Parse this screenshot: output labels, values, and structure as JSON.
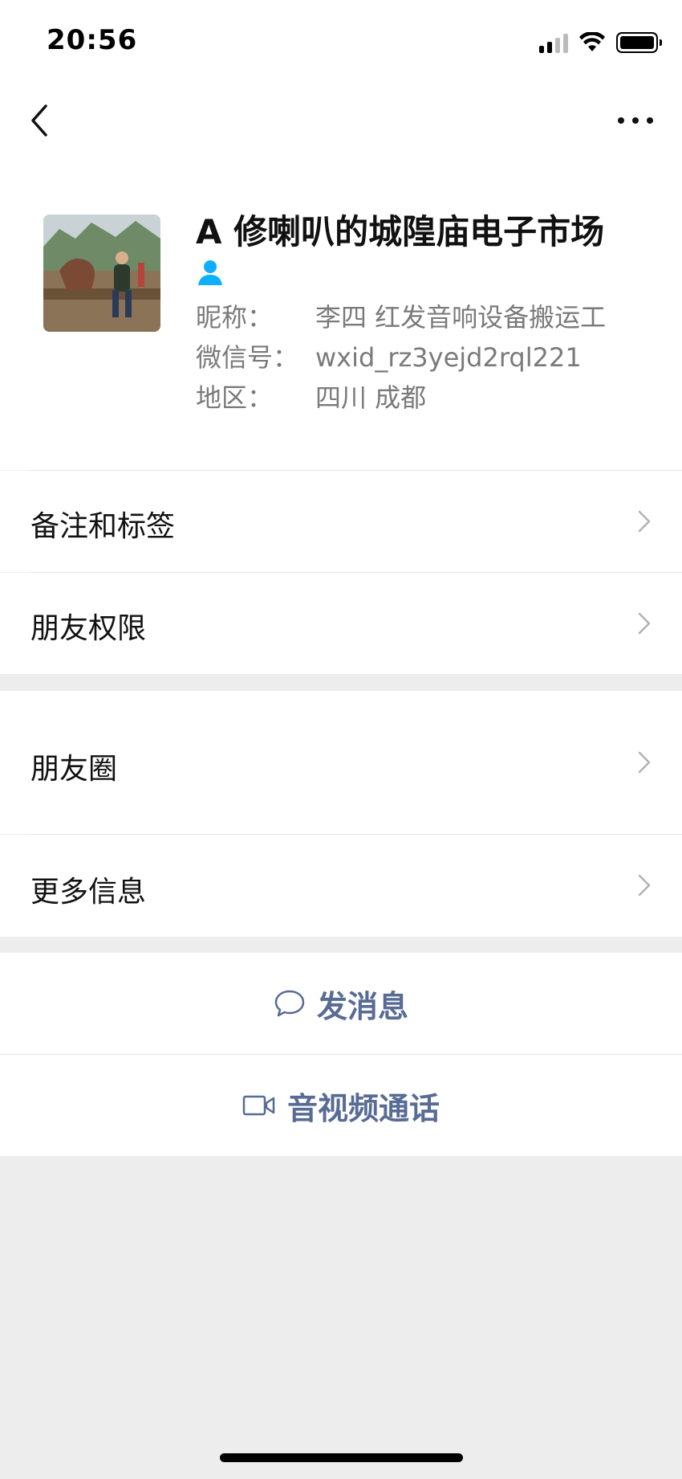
{
  "status_bar": {
    "time": "20:56"
  },
  "profile": {
    "name": "A 修喇叭的城隍庙电子市场",
    "nickname_label": "昵称：",
    "nickname_value": "李四 红发音响设备搬运工",
    "wechat_id_label": "微信号：",
    "wechat_id_value": "wxid_rz3yejd2rql221",
    "region_label": "地区：",
    "region_value": "四川 成都"
  },
  "menu": {
    "remarks_tags": "备注和标签",
    "friend_permissions": "朋友权限",
    "moments": "朋友圈",
    "more_info": "更多信息"
  },
  "actions": {
    "send_message": "发消息",
    "video_call": "音视频通话"
  },
  "colors": {
    "link_blue": "#576b95",
    "contact_icon_blue": "#10aeff",
    "background": "#ededed"
  }
}
